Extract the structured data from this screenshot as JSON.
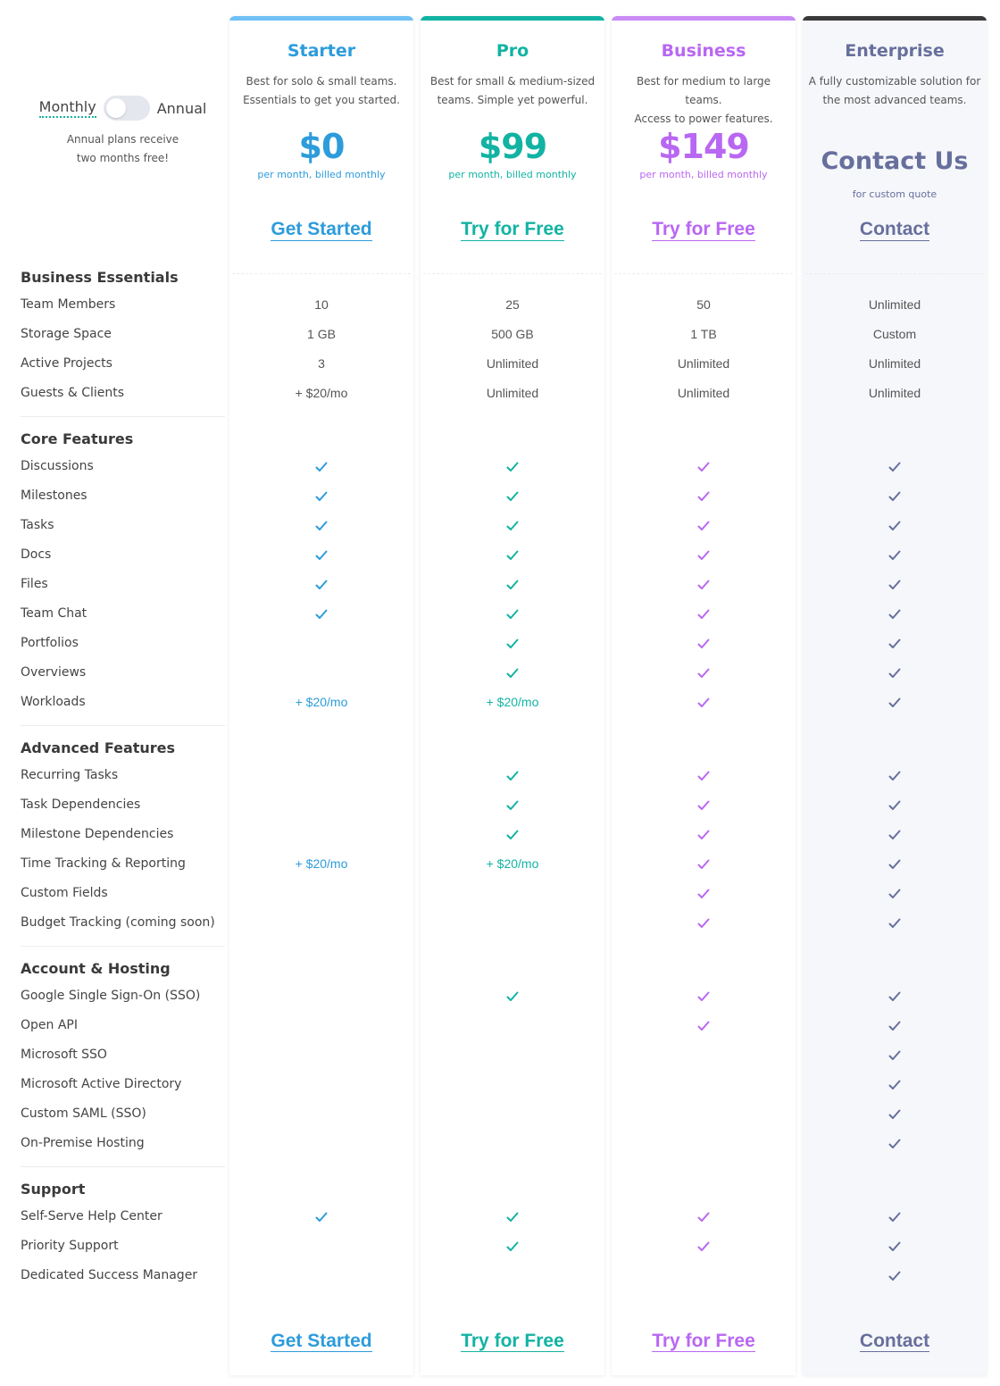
{
  "billing_toggle": {
    "monthly_label": "Monthly",
    "annual_label": "Annual",
    "selected": "Monthly",
    "note_line1": "Annual plans receive",
    "note_line2": "two months free!"
  },
  "plans": [
    {
      "key": "starter",
      "name": "Starter",
      "desc_line1": "Best for solo & small teams.",
      "desc_line2": "Essentials to get you started.",
      "price": "$0",
      "period": "per month, billed monthly",
      "cta": "Get Started",
      "color": "#2d9cdb",
      "bar_color": "#6fc0f5"
    },
    {
      "key": "pro",
      "name": "Pro",
      "desc_line1": "Best for small & medium-sized",
      "desc_line2": "teams. Simple yet powerful.",
      "price": "$99",
      "period": "per month, billed monthly",
      "cta": "Try for Free",
      "color": "#12b3a3",
      "bar_color": "#12b3a3"
    },
    {
      "key": "business",
      "name": "Business",
      "desc_line1": "Best for medium to large teams.",
      "desc_line2": "Access to power features.",
      "price": "$149",
      "period": "per month, billed monthly",
      "cta": "Try for Free",
      "color": "#b967f2",
      "bar_color": "#c98bf6"
    },
    {
      "key": "enterprise",
      "name": "Enterprise",
      "desc_line1": "A fully customizable solution for",
      "desc_line2": "the most advanced teams.",
      "price": "Contact Us",
      "period": "for custom quote",
      "cta": "Contact",
      "color": "#676f9d",
      "bar_color": "#3a3a3a"
    }
  ],
  "sections": [
    {
      "title": "Business Essentials",
      "features": [
        {
          "name": "Team Members",
          "values": [
            "10",
            "25",
            "50",
            "Unlimited"
          ]
        },
        {
          "name": "Storage Space",
          "values": [
            "1 GB",
            "500 GB",
            "1 TB",
            "Custom"
          ]
        },
        {
          "name": "Active Projects",
          "values": [
            "3",
            "Unlimited",
            "Unlimited",
            "Unlimited"
          ]
        },
        {
          "name": "Guests & Clients",
          "values": [
            "+ $20/mo",
            "Unlimited",
            "Unlimited",
            "Unlimited"
          ]
        }
      ]
    },
    {
      "title": "Core Features",
      "features": [
        {
          "name": "Discussions",
          "values": [
            "check",
            "check",
            "check",
            "check"
          ]
        },
        {
          "name": "Milestones",
          "values": [
            "check",
            "check",
            "check",
            "check"
          ]
        },
        {
          "name": "Tasks",
          "values": [
            "check",
            "check",
            "check",
            "check"
          ]
        },
        {
          "name": "Docs",
          "values": [
            "check",
            "check",
            "check",
            "check"
          ]
        },
        {
          "name": "Files",
          "values": [
            "check",
            "check",
            "check",
            "check"
          ]
        },
        {
          "name": "Team Chat",
          "values": [
            "check",
            "check",
            "check",
            "check"
          ]
        },
        {
          "name": "Portfolios",
          "values": [
            "",
            "check",
            "check",
            "check"
          ]
        },
        {
          "name": "Overviews",
          "values": [
            "",
            "check",
            "check",
            "check"
          ]
        },
        {
          "name": "Workloads",
          "values": [
            "addon:+ $20/mo",
            "addon:+ $20/mo",
            "check",
            "check"
          ]
        }
      ]
    },
    {
      "title": "Advanced Features",
      "features": [
        {
          "name": "Recurring Tasks",
          "values": [
            "",
            "check",
            "check",
            "check"
          ]
        },
        {
          "name": "Task Dependencies",
          "values": [
            "",
            "check",
            "check",
            "check"
          ]
        },
        {
          "name": "Milestone Dependencies",
          "values": [
            "",
            "check",
            "check",
            "check"
          ]
        },
        {
          "name": "Time Tracking & Reporting",
          "values": [
            "addon:+ $20/mo",
            "addon:+ $20/mo",
            "check",
            "check"
          ]
        },
        {
          "name": "Custom Fields",
          "values": [
            "",
            "",
            "check",
            "check"
          ]
        },
        {
          "name": "Budget Tracking (coming soon)",
          "values": [
            "",
            "",
            "check",
            "check"
          ]
        }
      ]
    },
    {
      "title": "Account & Hosting",
      "features": [
        {
          "name": "Google Single Sign-On (SSO)",
          "values": [
            "",
            "check",
            "check",
            "check"
          ]
        },
        {
          "name": "Open API",
          "values": [
            "",
            "",
            "check",
            "check"
          ]
        },
        {
          "name": "Microsoft SSO",
          "values": [
            "",
            "",
            "",
            "check"
          ]
        },
        {
          "name": "Microsoft Active Directory",
          "values": [
            "",
            "",
            "",
            "check"
          ]
        },
        {
          "name": "Custom SAML (SSO)",
          "values": [
            "",
            "",
            "",
            "check"
          ]
        },
        {
          "name": "On-Premise Hosting",
          "values": [
            "",
            "",
            "",
            "check"
          ]
        }
      ]
    },
    {
      "title": "Support",
      "features": [
        {
          "name": "Self-Serve Help Center",
          "values": [
            "check",
            "check",
            "check",
            "check"
          ]
        },
        {
          "name": "Priority Support",
          "values": [
            "",
            "check",
            "check",
            "check"
          ]
        },
        {
          "name": "Dedicated Success Manager",
          "values": [
            "",
            "",
            "",
            "check"
          ]
        }
      ]
    }
  ],
  "icons": {
    "check": "check-icon"
  }
}
